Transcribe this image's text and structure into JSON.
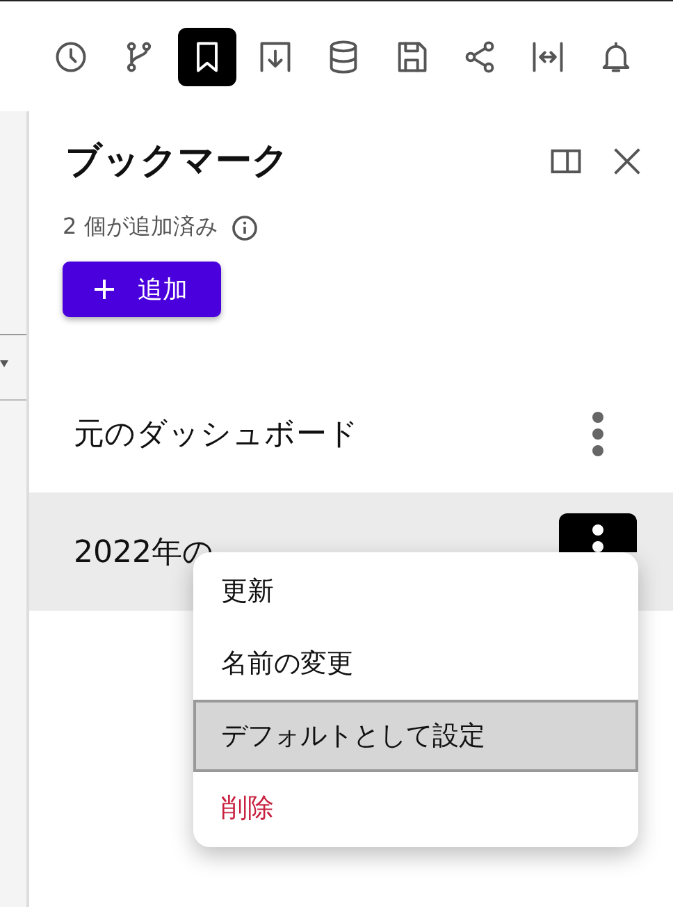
{
  "toolbar": [
    {
      "kind": "history",
      "selected": false
    },
    {
      "kind": "branch",
      "selected": false
    },
    {
      "kind": "bookmark",
      "selected": true
    },
    {
      "kind": "download",
      "selected": false
    },
    {
      "kind": "database",
      "selected": false
    },
    {
      "kind": "save",
      "selected": false
    },
    {
      "kind": "share",
      "selected": false
    },
    {
      "kind": "fit-width",
      "selected": false
    },
    {
      "kind": "bell",
      "selected": false
    }
  ],
  "panel": {
    "title": "ブックマーク",
    "count": "2 個が追加済み",
    "add_button": "追加"
  },
  "bookmarks": [
    {
      "name": "元のダッシュボード",
      "selected": false
    },
    {
      "name": "2022年の",
      "selected": true
    }
  ],
  "context_menu": {
    "items": [
      {
        "label": "更新",
        "kind": "normal",
        "selected": false
      },
      {
        "label": "名前の変更",
        "kind": "normal",
        "selected": false
      },
      {
        "label": "デフォルトとして設定",
        "kind": "normal",
        "selected": true
      },
      {
        "label": "削除",
        "kind": "danger",
        "selected": false
      }
    ]
  }
}
